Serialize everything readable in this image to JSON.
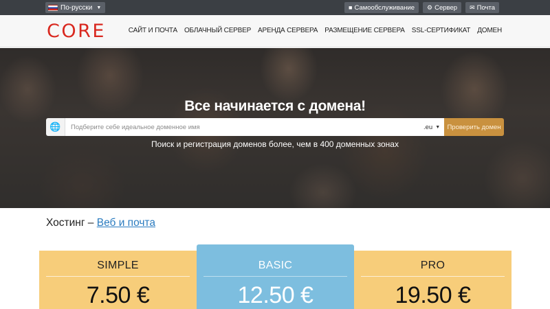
{
  "topbar": {
    "language": "По-русски",
    "links": [
      {
        "label": "Самообслуживание",
        "icon": "user-icon"
      },
      {
        "label": "Сервер",
        "icon": "gear-icon"
      },
      {
        "label": "Почта",
        "icon": "envelope-icon"
      }
    ]
  },
  "brand": {
    "logo": "CORE",
    "color": "#d9281f"
  },
  "nav": {
    "items": [
      "САЙТ И ПОЧТА",
      "ОБЛАЧНЫЙ СЕРВЕР",
      "АРЕНДА СЕРВЕРА",
      "РАЗМЕЩЕНИЕ СЕРВЕРА",
      "SSL-СЕРТИФИКАТ",
      "ДОМЕН"
    ]
  },
  "hero": {
    "title": "Все начинается с домена!",
    "search_placeholder": "Подберите себе идеальное доменное имя",
    "zone": ".eu",
    "check_button": "Проверить домен",
    "subtitle": "Поиск и регистрация доменов более, чем в 400 доменных зонах"
  },
  "hosting": {
    "prefix": "Хостинг –",
    "link": "Веб и почта"
  },
  "plans": [
    {
      "name": "SIMPLE",
      "price": "7.50 €",
      "color": "#f7cd7a"
    },
    {
      "name": "BASIC",
      "price": "12.50 €",
      "color": "#7dbedf"
    },
    {
      "name": "PRO",
      "price": "19.50 €",
      "color": "#f7cd7a"
    }
  ]
}
